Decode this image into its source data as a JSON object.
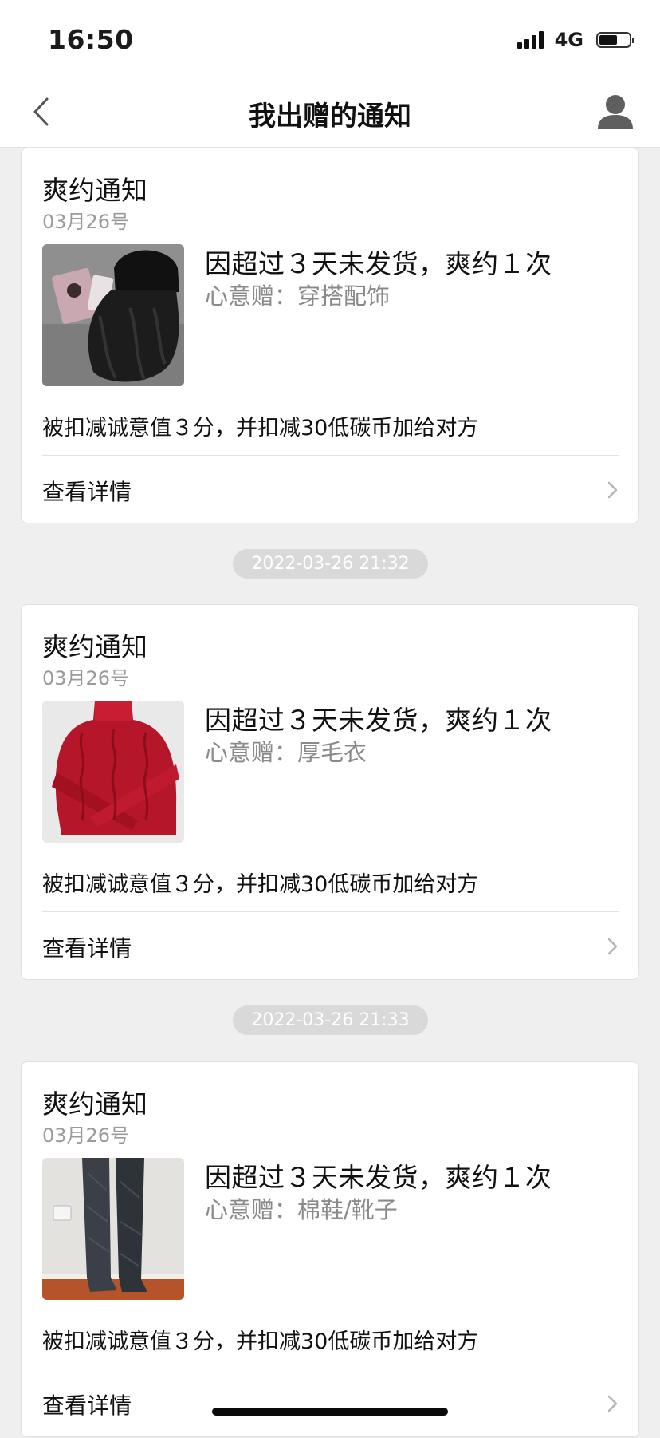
{
  "status_bar": {
    "time": "16:50",
    "network": "4G",
    "battery_level": 0.6
  },
  "nav": {
    "title": "我出赠的通知",
    "back_icon": "chevron-left-icon",
    "user_icon": "user-icon"
  },
  "notices": [
    {
      "title": "爽约通知",
      "date": "03月26号",
      "reason": "因超过３天未发货，爽约１次",
      "gift": "心意赠：穿搭配饰",
      "thumb": "wig-and-hat-photo",
      "penalty": "被扣减诚意值３分，并扣减30低碳币加给对方",
      "detail_label": "查看详情"
    },
    {
      "title": "爽约通知",
      "date": "03月26号",
      "reason": "因超过３天未发货，爽约１次",
      "gift": "心意赠：厚毛衣",
      "thumb": "red-sweater-photo",
      "penalty": "被扣减诚意值３分，并扣减30低碳币加给对方",
      "detail_label": "查看详情"
    },
    {
      "title": "爽约通知",
      "date": "03月26号",
      "reason": "因超过３天未发货，爽约１次",
      "gift": "心意赠：棉鞋/靴子",
      "thumb": "boots-photo",
      "penalty": "被扣减诚意值３分，并扣减30低碳币加给对方",
      "detail_label": "查看详情"
    }
  ],
  "timestamps": [
    "2022-03-26 21:32",
    "2022-03-26 21:33"
  ],
  "colors": {
    "background": "#efefef",
    "card": "#ffffff",
    "muted_text": "#8a8a8a",
    "timestamp_bg": "#d9d9d9"
  }
}
